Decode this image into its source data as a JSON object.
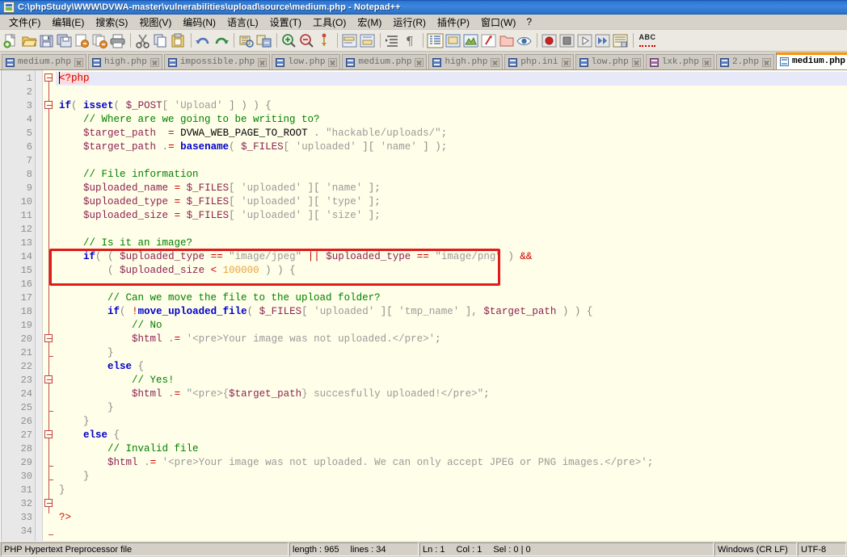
{
  "window": {
    "title": "C:\\phpStudy\\WWW\\DVWA-master\\vulnerabilities\\upload\\source\\medium.php - Notepad++",
    "icon": "notepad-plus-plus-icon"
  },
  "menu": {
    "items": [
      {
        "label": "文件(F)",
        "accel": "F"
      },
      {
        "label": "编辑(E)",
        "accel": "E"
      },
      {
        "label": "搜索(S)",
        "accel": "S"
      },
      {
        "label": "视图(V)",
        "accel": "V"
      },
      {
        "label": "编码(N)",
        "accel": "N"
      },
      {
        "label": "语言(L)",
        "accel": "L"
      },
      {
        "label": "设置(T)",
        "accel": "T"
      },
      {
        "label": "工具(O)",
        "accel": "O"
      },
      {
        "label": "宏(M)",
        "accel": "M"
      },
      {
        "label": "运行(R)",
        "accel": "R"
      },
      {
        "label": "插件(P)",
        "accel": "P"
      },
      {
        "label": "窗口(W)",
        "accel": "W"
      },
      {
        "label": "?",
        "accel": ""
      }
    ]
  },
  "toolbar": {
    "groups": [
      [
        "new-file-icon",
        "open-file-icon",
        "save-icon",
        "save-all-icon",
        "close-file-icon",
        "close-all-icon",
        "print-icon"
      ],
      [
        "cut-icon",
        "copy-icon",
        "paste-icon"
      ],
      [
        "undo-icon",
        "redo-icon"
      ],
      [
        "find-icon",
        "replace-icon"
      ],
      [
        "zoom-in-icon",
        "zoom-out-icon",
        "sync-scroll-icon"
      ],
      [
        "word-wrap-icon",
        "show-all-chars-icon"
      ],
      [
        "indent-guide-icon",
        "user-language-icon",
        "document-map-icon",
        "function-list-icon",
        "folder-as-workspace-icon",
        "preview-icon"
      ],
      [
        "record-macro-icon",
        "stop-macro-icon",
        "play-macro-icon",
        "fast-play-macro-icon",
        "save-macro-icon"
      ],
      [
        "spell-check-icon"
      ]
    ],
    "abc_label": "ABC"
  },
  "tabs": {
    "items": [
      {
        "label": "medium.php",
        "icon": "blue-doc-icon",
        "active": false
      },
      {
        "label": "high.php",
        "icon": "blue-doc-icon",
        "active": false
      },
      {
        "label": "impossible.php",
        "icon": "blue-doc-icon",
        "active": false
      },
      {
        "label": "low.php",
        "icon": "blue-doc-icon",
        "active": false
      },
      {
        "label": "medium.php",
        "icon": "blue-doc-icon",
        "active": false
      },
      {
        "label": "high.php",
        "icon": "blue-doc-icon",
        "active": false
      },
      {
        "label": "php.ini",
        "icon": "blue-doc-icon",
        "active": false
      },
      {
        "label": "low.php",
        "icon": "blue-doc-icon",
        "active": false
      },
      {
        "label": "lxk.php",
        "icon": "purple-doc-icon",
        "active": false
      },
      {
        "label": "2.php",
        "icon": "blue-doc-icon",
        "active": false
      },
      {
        "label": "medium.php",
        "icon": "white-doc-icon",
        "active": true
      }
    ],
    "active_accent_color": "#ff9000",
    "close_icon": "close-tab-icon"
  },
  "editor": {
    "current_line": 1,
    "total_lines": 34,
    "line_numbers": [
      1,
      2,
      3,
      4,
      5,
      6,
      7,
      8,
      9,
      10,
      11,
      12,
      13,
      14,
      15,
      16,
      17,
      18,
      19,
      20,
      21,
      22,
      23,
      24,
      25,
      26,
      27,
      28,
      29,
      30,
      31,
      32,
      33,
      34
    ],
    "lines": [
      "<?php",
      "",
      "if( isset( $_POST[ 'Upload' ] ) ) {",
      "    // Where are we going to be writing to?",
      "    $target_path  = DVWA_WEB_PAGE_TO_ROOT . \"hackable/uploads/\";",
      "    $target_path .= basename( $_FILES[ 'uploaded' ][ 'name' ] );",
      "",
      "    // File information",
      "    $uploaded_name = $_FILES[ 'uploaded' ][ 'name' ];",
      "    $uploaded_type = $_FILES[ 'uploaded' ][ 'type' ];",
      "    $uploaded_size = $_FILES[ 'uploaded' ][ 'size' ];",
      "",
      "    // Is it an image?",
      "    if( ( $uploaded_type == \"image/jpeg\" || $uploaded_type == \"image/png\" ) &&",
      "        ( $uploaded_size < 100000 ) ) {",
      "",
      "        // Can we move the file to the upload folder?",
      "        if( !move_uploaded_file( $_FILES[ 'uploaded' ][ 'tmp_name' ], $target_path ) ) {",
      "            // No",
      "            $html .= '<pre>Your image was not uploaded.</pre>';",
      "        }",
      "        else {",
      "            // Yes!",
      "            $html .= \"<pre>{$target_path} succesfully uploaded!</pre>\";",
      "        }",
      "    }",
      "    else {",
      "        // Invalid file",
      "        $html .= '<pre>Your image was not uploaded. We can only accept JPEG or PNG images.</pre>';",
      "    }",
      "}",
      "",
      "?>",
      ""
    ],
    "annotation": {
      "name": "red-highlight-box",
      "color": "#e01b1b",
      "covers_lines": "14-15"
    }
  },
  "statusbar": {
    "file_type": "PHP Hypertext Preprocessor file",
    "length_label": "length : 965",
    "lines_label": "lines : 34",
    "ln_label": "Ln : 1",
    "col_label": "Col : 1",
    "sel_label": "Sel : 0 | 0",
    "eol": "Windows (CR LF)",
    "encoding": "UTF-8"
  }
}
